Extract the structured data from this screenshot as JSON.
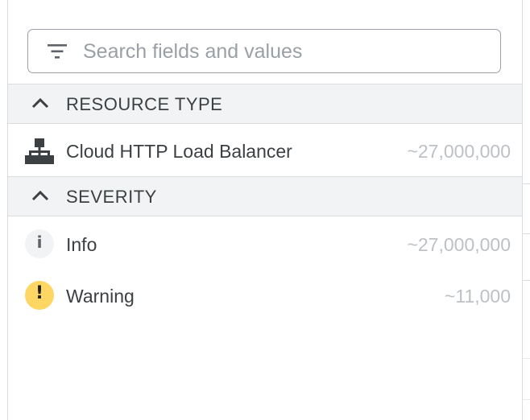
{
  "search": {
    "placeholder": "Search fields and values",
    "value": "",
    "icon": "filter-icon"
  },
  "sections": [
    {
      "title": "RESOURCE TYPE",
      "expanded": true,
      "icon": "chevron-up-icon",
      "items": [
        {
          "label": "Cloud HTTP Load Balancer",
          "count": "~27,000,000",
          "icon": "network-hierarchy-icon"
        }
      ]
    },
    {
      "title": "SEVERITY",
      "expanded": true,
      "icon": "chevron-up-icon",
      "items": [
        {
          "label": "Info",
          "count": "~27,000,000",
          "icon": "info-icon",
          "badge_color": "#f1f3f4",
          "glyph": "i"
        },
        {
          "label": "Warning",
          "count": "~11,000",
          "icon": "warning-icon",
          "badge_color": "#fdd663",
          "glyph": "!"
        }
      ]
    }
  ],
  "colors": {
    "header_bg": "#f1f3f4",
    "text": "#3c4043",
    "count_text": "#bdc1c6",
    "border": "#dadce0",
    "warning": "#fdd663"
  }
}
